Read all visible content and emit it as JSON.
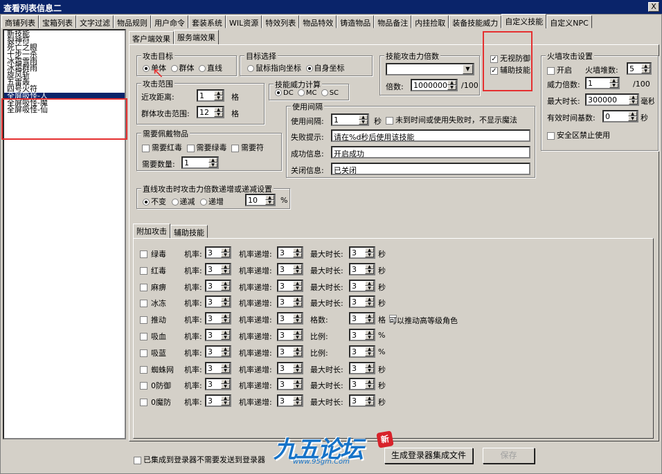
{
  "window": {
    "title": "查看列表信息二",
    "close_label": "X"
  },
  "top_tabs": [
    "商铺列表",
    "宝箱列表",
    "文字过滤",
    "物品规则",
    "用户命令",
    "套装系统",
    "WIL资源",
    "特效列表",
    "物品特效",
    "铸造物品",
    "物品备注",
    "内挂捡取",
    "装备技能威力",
    "自定义技能",
    "自定义NPC"
  ],
  "list_items": [
    "新技能",
    "裂神符",
    "死亡之眼",
    "十步一杀",
    "冰霜雪雨",
    "冰霜群雨",
    "旋风斩",
    "五雷轰",
    "四号火符",
    "全屏吸怪-人",
    "全屏吸怪-魔",
    "全屏吸怪-仙"
  ],
  "sub_tabs": [
    "客户端效果",
    "服务端效果"
  ],
  "attack_target": {
    "label": "攻击目标",
    "opt1": "单体",
    "opt2": "群体",
    "opt3": "直线"
  },
  "target_select": {
    "label": "目标选择",
    "opt1": "鼠标指向坐标",
    "opt2": "自身坐标"
  },
  "skill_multiplier": {
    "label": "技能攻击力倍数",
    "mult_label": "倍数:",
    "mult_value": "1000000",
    "unit": "/100"
  },
  "flags": {
    "ignore_def": "无视防御",
    "assist": "辅助技能"
  },
  "firewall": {
    "label": "火墙攻击设置",
    "enable": "开启",
    "stack_label": "火墙堆数:",
    "stack_value": "5",
    "power_label": "威力倍数:",
    "power_value": "1",
    "power_unit": "/100",
    "maxtime_label": "最大时长:",
    "maxtime_value": "300000",
    "maxtime_unit": "毫秒",
    "base_label": "有效时间基数:",
    "base_value": "0",
    "base_unit": "秒",
    "safe_label": "安全区禁止使用"
  },
  "attack_range": {
    "label": "攻击范围",
    "near_label": "近攻距离:",
    "near_value": "1",
    "near_unit": "格",
    "group_label": "群体攻击范围:",
    "group_value": "12",
    "group_unit": "格"
  },
  "power_calc": {
    "label": "技能威力计算",
    "dc": "DC",
    "mc": "MC",
    "sc": "SC"
  },
  "interval": {
    "label": "使用间隔",
    "use_label": "使用间隔:",
    "use_value": "1",
    "use_unit": "秒",
    "notime_label": "未到时间或使用失败时，不显示魔法",
    "fail_label": "失败提示:",
    "fail_value": "请在%d秒后使用该技能",
    "success_label": "成功信息:",
    "success_value": "开启成功",
    "close_label": "关闭信息:",
    "close_value": "已关闭"
  },
  "equip": {
    "label": "需要佩戴物品",
    "red": "需要红毒",
    "green": "需要绿毒",
    "talisman": "需要符",
    "qty_label": "需要数量:",
    "qty_value": "1"
  },
  "line_attack": {
    "label": "直线攻击时攻击力倍数递增或递减设置",
    "opt1": "不变",
    "opt2": "递减",
    "opt3": "递增",
    "value": "10",
    "unit": "%"
  },
  "bottom_tabs": [
    "附加攻击",
    "辅助技能"
  ],
  "effects": [
    {
      "name": "绿毒",
      "rate": "机率:",
      "rv": "3",
      "inc": "机率递增:",
      "iv": "3",
      "extra": "最大时长:",
      "ev": "3",
      "unit": "秒"
    },
    {
      "name": "红毒",
      "rate": "机率:",
      "rv": "3",
      "inc": "机率递增:",
      "iv": "3",
      "extra": "最大时长:",
      "ev": "3",
      "unit": "秒"
    },
    {
      "name": "麻痹",
      "rate": "机率:",
      "rv": "3",
      "inc": "机率递增:",
      "iv": "3",
      "extra": "最大时长:",
      "ev": "3",
      "unit": "秒"
    },
    {
      "name": "冰冻",
      "rate": "机率:",
      "rv": "3",
      "inc": "机率递增:",
      "iv": "3",
      "extra": "最大时长:",
      "ev": "3",
      "unit": "秒"
    },
    {
      "name": "推动",
      "rate": "机率:",
      "rv": "3",
      "inc": "机率递增:",
      "iv": "3",
      "extra": "格数:",
      "ev": "3",
      "unit": "格"
    },
    {
      "name": "吸血",
      "rate": "机率:",
      "rv": "3",
      "inc": "机率递增:",
      "iv": "3",
      "extra": "比例:",
      "ev": "3",
      "unit": "%"
    },
    {
      "name": "吸蓝",
      "rate": "机率:",
      "rv": "3",
      "inc": "机率递增:",
      "iv": "3",
      "extra": "比例:",
      "ev": "3",
      "unit": "%"
    },
    {
      "name": "蜘蛛网",
      "rate": "机率:",
      "rv": "3",
      "inc": "机率递增:",
      "iv": "3",
      "extra": "最大时长:",
      "ev": "3",
      "unit": "秒"
    },
    {
      "name": "0防御",
      "rate": "机率:",
      "rv": "3",
      "inc": "机率递增:",
      "iv": "3",
      "extra": "最大时长:",
      "ev": "3",
      "unit": "秒"
    },
    {
      "name": "0魔防",
      "rate": "机率:",
      "rv": "3",
      "inc": "机率递增:",
      "iv": "3",
      "extra": "最大时长:",
      "ev": "3",
      "unit": "秒"
    }
  ],
  "push_high": "可以推动高等级角色",
  "bottom": {
    "integrated": "已集成到登录器不需要发送到登录器",
    "generate": "生成登录器集成文件",
    "save": "保存"
  },
  "watermark": {
    "brand": "九五论坛",
    "url": "www.95gm.Com",
    "badge": "新"
  }
}
